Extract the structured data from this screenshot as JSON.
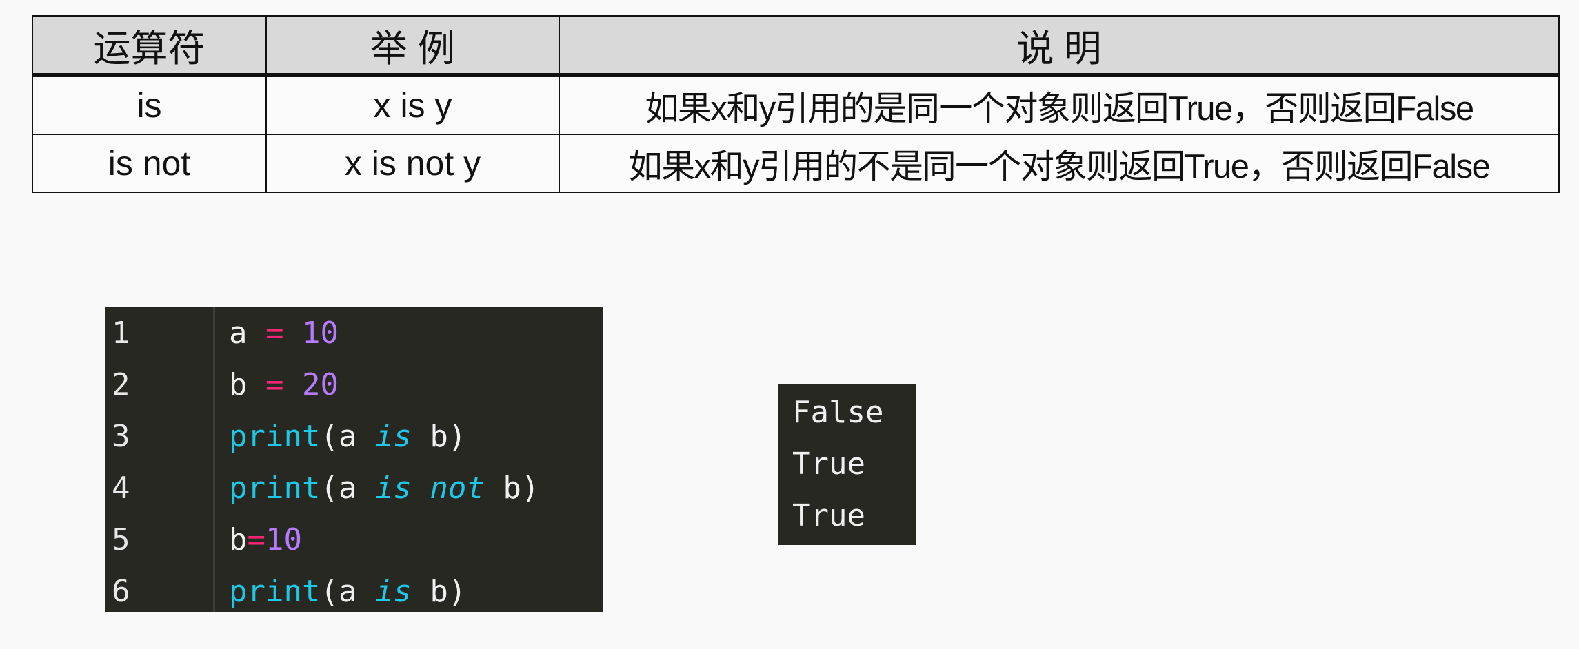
{
  "table": {
    "headers": [
      "运算符",
      "举  例",
      "说  明"
    ],
    "rows": [
      {
        "operator": "is",
        "example": "x is y",
        "description": "如果x和y引用的是同一个对象则返回True，否则返回False"
      },
      {
        "operator": "is not",
        "example": "x is not y",
        "description": "如果x和y引用的不是同一个对象则返回True，否则返回False"
      }
    ]
  },
  "code": {
    "lines": [
      {
        "num": "1",
        "tokens": [
          {
            "t": "a",
            "k": "txt"
          },
          {
            "t": " ",
            "k": "txt"
          },
          {
            "t": "=",
            "k": "op"
          },
          {
            "t": " ",
            "k": "txt"
          },
          {
            "t": "10",
            "k": "num"
          }
        ]
      },
      {
        "num": "2",
        "tokens": [
          {
            "t": "b",
            "k": "txt"
          },
          {
            "t": " ",
            "k": "txt"
          },
          {
            "t": "=",
            "k": "op"
          },
          {
            "t": " ",
            "k": "txt"
          },
          {
            "t": "20",
            "k": "num"
          }
        ]
      },
      {
        "num": "3",
        "tokens": [
          {
            "t": "print",
            "k": "fn"
          },
          {
            "t": "(a ",
            "k": "txt"
          },
          {
            "t": "is",
            "k": "kw"
          },
          {
            "t": " b)",
            "k": "txt"
          }
        ]
      },
      {
        "num": "4",
        "tokens": [
          {
            "t": "print",
            "k": "fn"
          },
          {
            "t": "(a ",
            "k": "txt"
          },
          {
            "t": "is",
            "k": "kw"
          },
          {
            "t": " ",
            "k": "txt"
          },
          {
            "t": "not",
            "k": "kw"
          },
          {
            "t": " b)",
            "k": "txt"
          }
        ]
      },
      {
        "num": "5",
        "tokens": [
          {
            "t": "b",
            "k": "txt"
          },
          {
            "t": "=",
            "k": "op"
          },
          {
            "t": "10",
            "k": "num"
          }
        ]
      },
      {
        "num": "6",
        "tokens": [
          {
            "t": "print",
            "k": "fn"
          },
          {
            "t": "(a ",
            "k": "txt"
          },
          {
            "t": "is",
            "k": "kw"
          },
          {
            "t": " b)",
            "k": "txt"
          }
        ]
      }
    ]
  },
  "output": {
    "lines": [
      "False",
      "True",
      "True"
    ]
  },
  "colors": {
    "editor_bg": "#272822",
    "operator": "#f92672",
    "number": "#b87bff",
    "keyword": "#1ec8e8",
    "header_bg": "#d9d9d9"
  }
}
